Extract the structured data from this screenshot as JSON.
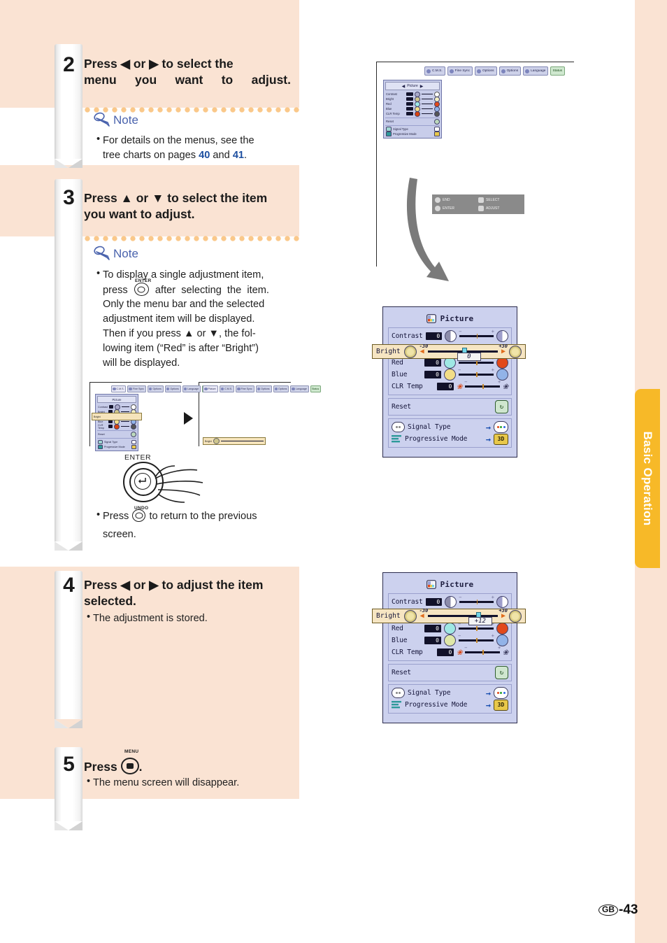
{
  "page": {
    "number_label": "-43",
    "region_code": "GB",
    "side_tab": "Basic Operation"
  },
  "steps": [
    {
      "num": "2",
      "heading_line1": "Press ◀ or ▶ to select the",
      "heading_line2": "menu you want to adjust.",
      "note_label": "Note",
      "note_lines": [
        "For details on the menus, see the",
        "tree charts on pages 40 and 41."
      ],
      "note_refs": [
        "40",
        "41"
      ]
    },
    {
      "num": "3",
      "heading_line1": "Press ▲ or ▼ to select the item",
      "heading_line2": "you want to adjust.",
      "note_label": "Note",
      "note_lines": [
        "To display a single adjustment item,",
        "press        after  selecting  the  item.",
        "Only the menu bar and the selected",
        "adjustment item will be displayed.",
        "Then if you press ▲ or ▼, the fol-",
        "lowing item (“Red” is after “Bright”)",
        "will be displayed."
      ],
      "enter_key_cap": "ENTER",
      "undo_key_cap": "UNDO",
      "undo_line1": "Press",
      "undo_line2": "to return to the previous",
      "undo_line3": "screen."
    },
    {
      "num": "4",
      "heading_line1": "Press ◀ or ▶ to adjust the item",
      "heading_line2": "selected.",
      "bullet": "The adjustment is stored."
    },
    {
      "num": "5",
      "heading_prefix": "Press",
      "heading_suffix": ".",
      "menu_key_cap": "MENU",
      "bullet": "The menu screen will disappear."
    }
  ],
  "osd": {
    "title": "Picture",
    "menubar_tabs": [
      {
        "label": "C.M.S.",
        "icon": "cms-icon",
        "type": "normal"
      },
      {
        "label": "Fine Sync",
        "icon": "fine-sync-icon",
        "type": "normal"
      },
      {
        "label": "Options",
        "icon": "options1-icon",
        "type": "normal"
      },
      {
        "label": "Options",
        "icon": "options2-icon",
        "type": "normal"
      },
      {
        "label": "Language",
        "icon": "language-icon",
        "type": "normal"
      },
      {
        "label": "Status",
        "icon": "status-icon",
        "type": "status"
      }
    ],
    "help_box": [
      {
        "label": "END",
        "icon": "end-button-icon"
      },
      {
        "label": "SELECT",
        "icon": "dpad-icon"
      },
      {
        "label": "ENTER",
        "icon": "enter-button-icon"
      },
      {
        "label": "ADJUST",
        "icon": "dpad-icon"
      }
    ],
    "rows_group1": [
      {
        "label": "Contrast",
        "value": "0",
        "sw_left": "contrast-swatch",
        "sw_right": "contrast-swatch-light"
      },
      {
        "label": "Red",
        "value": "0",
        "sw_left": "cyan-swatch",
        "sw_right": "red-swatch"
      },
      {
        "label": "Blue",
        "value": "0",
        "sw_left": "yellow-swatch",
        "sw_right": "blue-swatch"
      },
      {
        "label": "CLR Temp",
        "value": "0",
        "sw_left": "flower-warm-icon",
        "sw_right": "flower-cool-icon"
      }
    ],
    "reset_row": {
      "label": "Reset",
      "icon": "reset-icon"
    },
    "submenu_rows": [
      {
        "label": "Signal Type",
        "icon": "signal-type-icon",
        "arrow": "→",
        "right_icon": "rgb-dots-icon"
      },
      {
        "label": "Progressive Mode",
        "icon": "progressive-mode-icon",
        "arrow": "→",
        "right_icon": "3d-icon"
      }
    ],
    "bright_row": {
      "label": "Bright",
      "icon": "brightness-gear-icon",
      "min": "-30",
      "max": "+30",
      "value_step3": "0",
      "value_step4": "+12",
      "left_arrow": "◀",
      "right_arrow": "▶"
    }
  },
  "thumbnails": {
    "left_caption_label": "Bright",
    "right_caption_label": "Bright",
    "transition_arrow": "▶"
  },
  "colors": {
    "page_bg": "#fae3d3",
    "note_bg": "#ffffff",
    "note_dot": "#fac88a",
    "note_title": "#4a63ad",
    "side_tab": "#f7b928",
    "osd_panel": "#ccd1ee",
    "osd_highlight": "#f6e5c2",
    "link_blue": "#1d4fa0"
  }
}
